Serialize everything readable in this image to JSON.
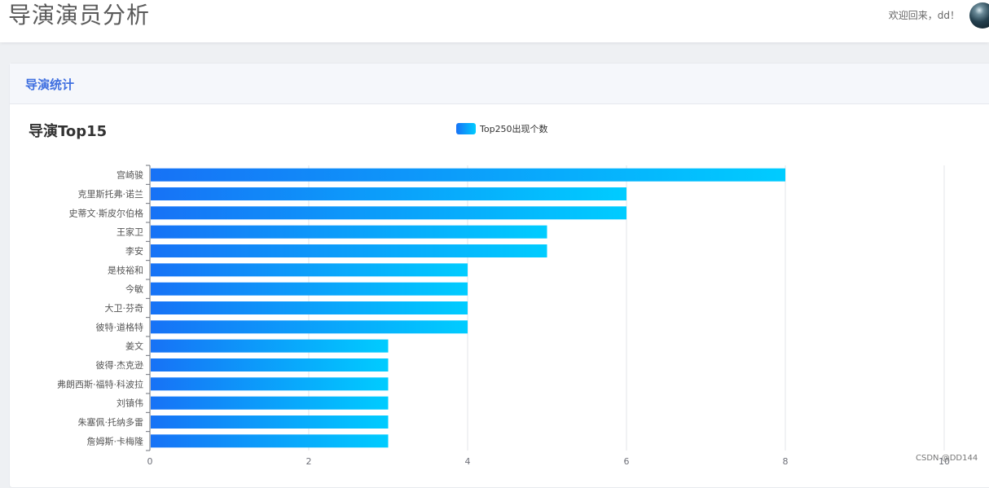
{
  "header": {
    "title": "导演演员分析",
    "welcome_text": "欢迎回来，dd！"
  },
  "card": {
    "title": "导演统计"
  },
  "chart_data": {
    "type": "bar",
    "orientation": "horizontal",
    "title": "导演Top15",
    "legend": "Top250出现个数",
    "legend_position": "top-center",
    "categories": [
      "宫崎骏",
      "克里斯托弗·诺兰",
      "史蒂文·斯皮尔伯格",
      "王家卫",
      "李安",
      "是枝裕和",
      "今敏",
      "大卫·芬奇",
      "彼特·道格特",
      "姜文",
      "彼得·杰克逊",
      "弗朗西斯·福特·科波拉",
      "刘镇伟",
      "朱塞佩·托纳多雷",
      "詹姆斯·卡梅隆"
    ],
    "series": [
      {
        "name": "Top250出现个数",
        "values": [
          8,
          6,
          6,
          5,
          5,
          4,
          4,
          4,
          4,
          3,
          3,
          3,
          3,
          3,
          3
        ]
      }
    ],
    "x_ticks": [
      0,
      2,
      4,
      6,
      8,
      10
    ],
    "xlim": [
      0,
      10
    ],
    "grid": true,
    "bar_gradient": [
      "#1772f6",
      "#00ccff"
    ]
  },
  "watermark": "CSDN @DD144"
}
